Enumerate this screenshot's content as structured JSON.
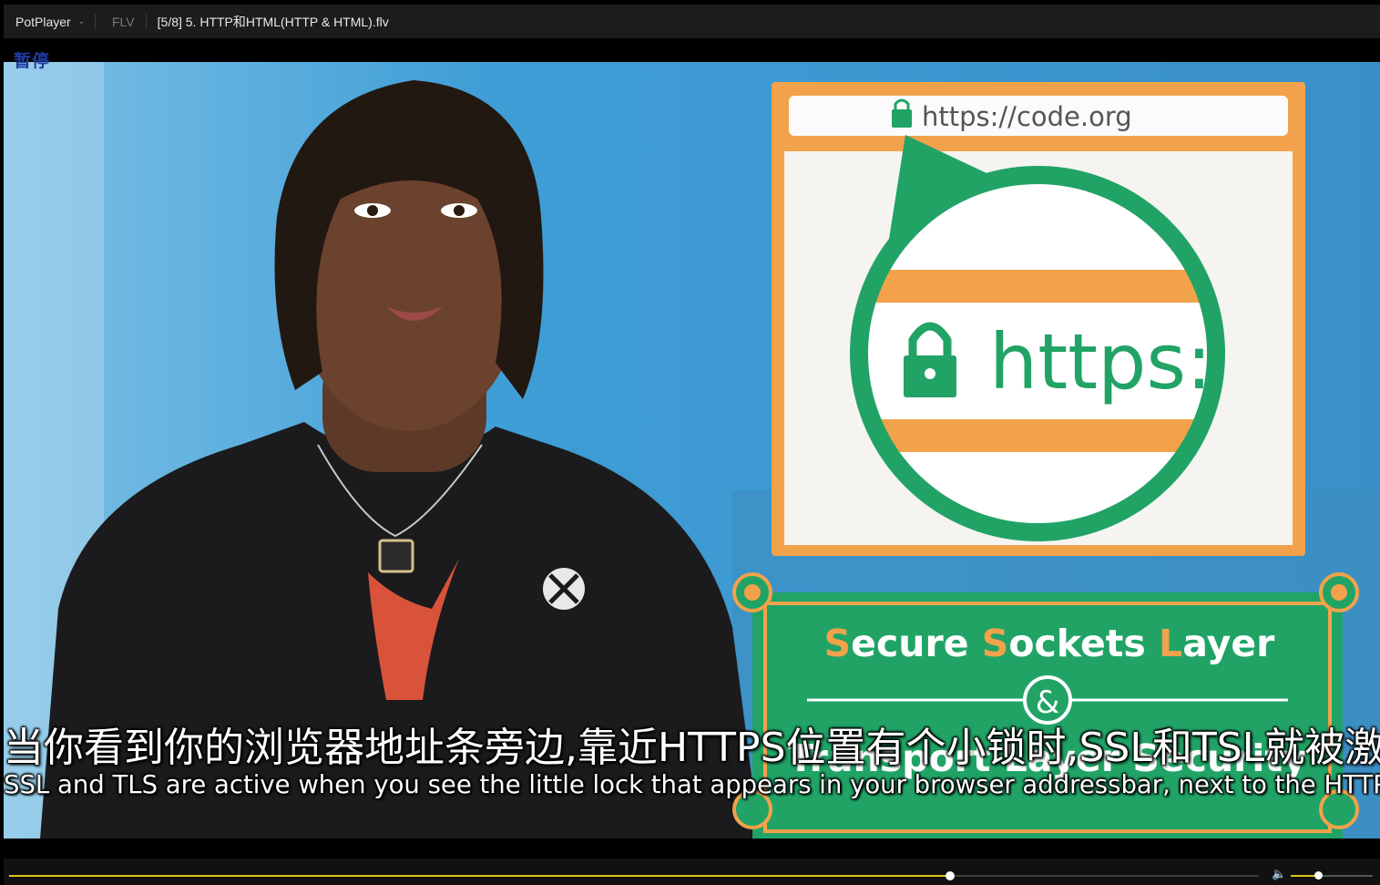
{
  "titlebar": {
    "app_name": "PotPlayer",
    "format": "FLV",
    "file_title": "[5/8] 5. HTTP和HTML(HTTP & HTML).flv"
  },
  "overlay": {
    "status": "暂停"
  },
  "video": {
    "url_text": "https://code.org",
    "magnified_text": "https:",
    "card_title_parts": [
      "S",
      "ecure ",
      "S",
      "ockets ",
      "L",
      "ayer"
    ],
    "card_ampersand": "&",
    "card_subtitle": "Transport Layer Security"
  },
  "subtitles": {
    "chinese": "当你看到你的浏览器地址条旁边,靠近HTTPS位置有个小锁时,SSL和TSL就被激活了",
    "english": "SSL and TLS are active when you see the little lock that appears in your browser addressbar, next to the HTTPS"
  },
  "playback": {
    "progress": 0.753,
    "volume": 0.33
  },
  "colors": {
    "accent": "#e0c21a",
    "paused_text": "#1f3aa0",
    "card_green": "#21a366",
    "card_orange": "#f2a24a"
  },
  "icons": {
    "app_menu": "chevron-down-icon",
    "volume": "speaker-icon",
    "lock": "lock-icon"
  }
}
